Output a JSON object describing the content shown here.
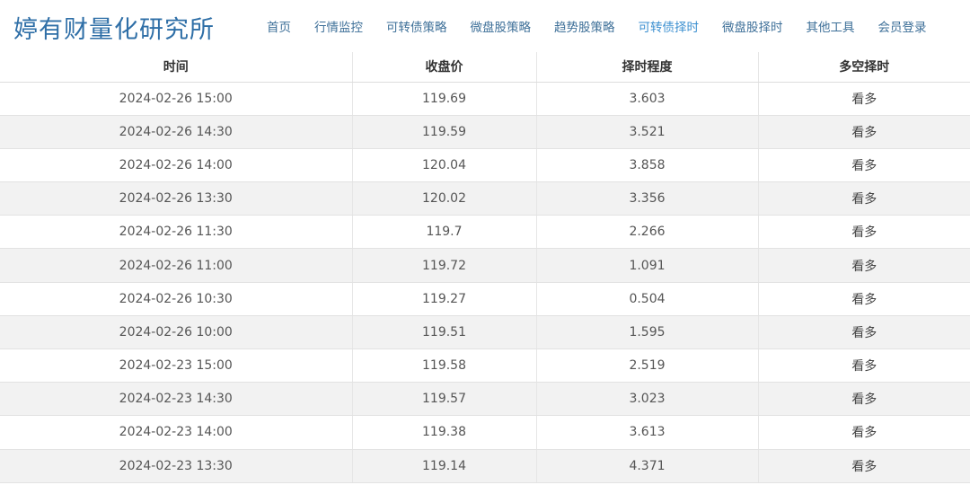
{
  "brand": "婷有财量化研究所",
  "nav": [
    {
      "label": "首页",
      "active": false
    },
    {
      "label": "行情监控",
      "active": false
    },
    {
      "label": "可转债策略",
      "active": false
    },
    {
      "label": "微盘股策略",
      "active": false
    },
    {
      "label": "趋势股策略",
      "active": false
    },
    {
      "label": "可转债择时",
      "active": true
    },
    {
      "label": "微盘股择时",
      "active": false
    },
    {
      "label": "其他工具",
      "active": false
    },
    {
      "label": "会员登录",
      "active": false
    }
  ],
  "table": {
    "headers": [
      "时间",
      "收盘价",
      "择时程度",
      "多空择时"
    ],
    "rows": [
      [
        "2024-02-26 15:00",
        "119.69",
        "3.603",
        "看多"
      ],
      [
        "2024-02-26 14:30",
        "119.59",
        "3.521",
        "看多"
      ],
      [
        "2024-02-26 14:00",
        "120.04",
        "3.858",
        "看多"
      ],
      [
        "2024-02-26 13:30",
        "120.02",
        "3.356",
        "看多"
      ],
      [
        "2024-02-26 11:30",
        "119.7",
        "2.266",
        "看多"
      ],
      [
        "2024-02-26 11:00",
        "119.72",
        "1.091",
        "看多"
      ],
      [
        "2024-02-26 10:30",
        "119.27",
        "0.504",
        "看多"
      ],
      [
        "2024-02-26 10:00",
        "119.51",
        "1.595",
        "看多"
      ],
      [
        "2024-02-23 15:00",
        "119.58",
        "2.519",
        "看多"
      ],
      [
        "2024-02-23 14:30",
        "119.57",
        "3.023",
        "看多"
      ],
      [
        "2024-02-23 14:00",
        "119.38",
        "3.613",
        "看多"
      ],
      [
        "2024-02-23 13:30",
        "119.14",
        "4.371",
        "看多"
      ]
    ]
  }
}
